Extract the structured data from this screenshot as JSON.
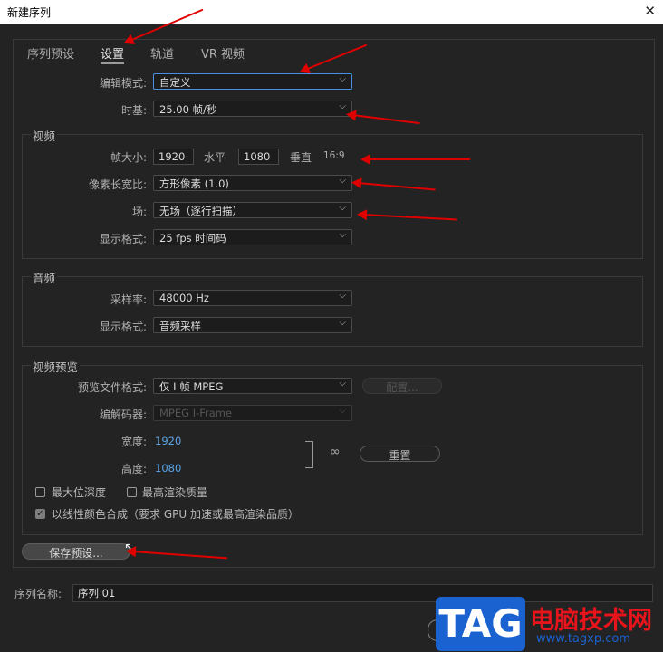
{
  "window": {
    "title": "新建序列",
    "close": "✕"
  },
  "tabs": [
    "序列预设",
    "设置",
    "轨道",
    "VR 视频"
  ],
  "settings": {
    "edit_mode": {
      "label": "编辑模式:",
      "value": "自定义"
    },
    "timebase": {
      "label": "时基:",
      "value": "25.00  帧/秒"
    }
  },
  "video": {
    "title": "视频",
    "frame_size": {
      "label": "帧大小:",
      "width": "1920",
      "h_label": "水平",
      "height": "1080",
      "v_label": "垂直",
      "ratio": "16:9"
    },
    "pixel_aspect": {
      "label": "像素长宽比:",
      "value": "方形像素 (1.0)"
    },
    "fields": {
      "label": "场:",
      "value": "无场（逐行扫描）"
    },
    "display_format": {
      "label": "显示格式:",
      "value": "25 fps 时间码"
    }
  },
  "audio": {
    "title": "音频",
    "sample_rate": {
      "label": "采样率:",
      "value": "48000 Hz"
    },
    "display_format": {
      "label": "显示格式:",
      "value": "音频采样"
    }
  },
  "preview": {
    "title": "视频预览",
    "file_format": {
      "label": "预览文件格式:",
      "value": "仅 I 帧 MPEG"
    },
    "configure": "配置...",
    "codec": {
      "label": "编解码器:",
      "value": "MPEG I-Frame"
    },
    "width": {
      "label": "宽度:",
      "value": "1920"
    },
    "height": {
      "label": "高度:",
      "value": "1080"
    },
    "reset": "重置",
    "max_bit_depth": {
      "label": "最大位深度",
      "checked": false
    },
    "max_render_quality": {
      "label": "最高渲染质量",
      "checked": false
    },
    "linear_color": {
      "label": "以线性颜色合成（要求 GPU 加速或最高渲染品质）",
      "checked": true
    }
  },
  "save_preset": "保存预设...",
  "sequence_name": {
    "label": "序列名称:",
    "value": "序列 01"
  },
  "watermark": {
    "tag": "TAG",
    "site": "电脑技术网",
    "url": "www.tagxp.com"
  },
  "annotation_color": "#e00000",
  "icons": [
    "close-icon",
    "chevron-down-icon",
    "link-icon",
    "checkbox-icon",
    "cursor-icon"
  ]
}
